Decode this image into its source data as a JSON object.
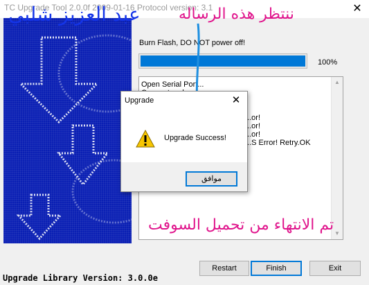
{
  "window": {
    "title": "TC Upgrade Tool 2.0.0f 2009-01-16 Protocol version: 3.1",
    "close_glyph": "✕"
  },
  "panel": {
    "status_text": "Burn Flash, DO NOT power off!",
    "progress": {
      "value": 100,
      "label": "100%"
    },
    "log_lines": [
      "Open Serial Port...",
      "Connect ...ok",
      "",
      "",
      "...or!",
      "...or!",
      "...or!",
      "...S Error! Retry.OK"
    ]
  },
  "footer": {
    "library_version": "Upgrade Library Version: 3.0.0e"
  },
  "buttons": {
    "restart": "Restart",
    "finish": "Finish",
    "exit": "Exit"
  },
  "dialog": {
    "title": "Upgrade",
    "message": "Upgrade Success!",
    "ok_label": "موافق",
    "close_glyph": "✕",
    "icon": "warning-icon"
  },
  "overlays": {
    "top_note": "ننتظر هذه الرساله",
    "bottom_note": "تم الانتهاء من تحميل السوفت",
    "author": "عبد العزيز شلبي",
    "color": "#e0148c",
    "author_color": "#1535e8"
  },
  "colors": {
    "progress": "#0078d7",
    "panel_bg": "#0a1fb4"
  }
}
